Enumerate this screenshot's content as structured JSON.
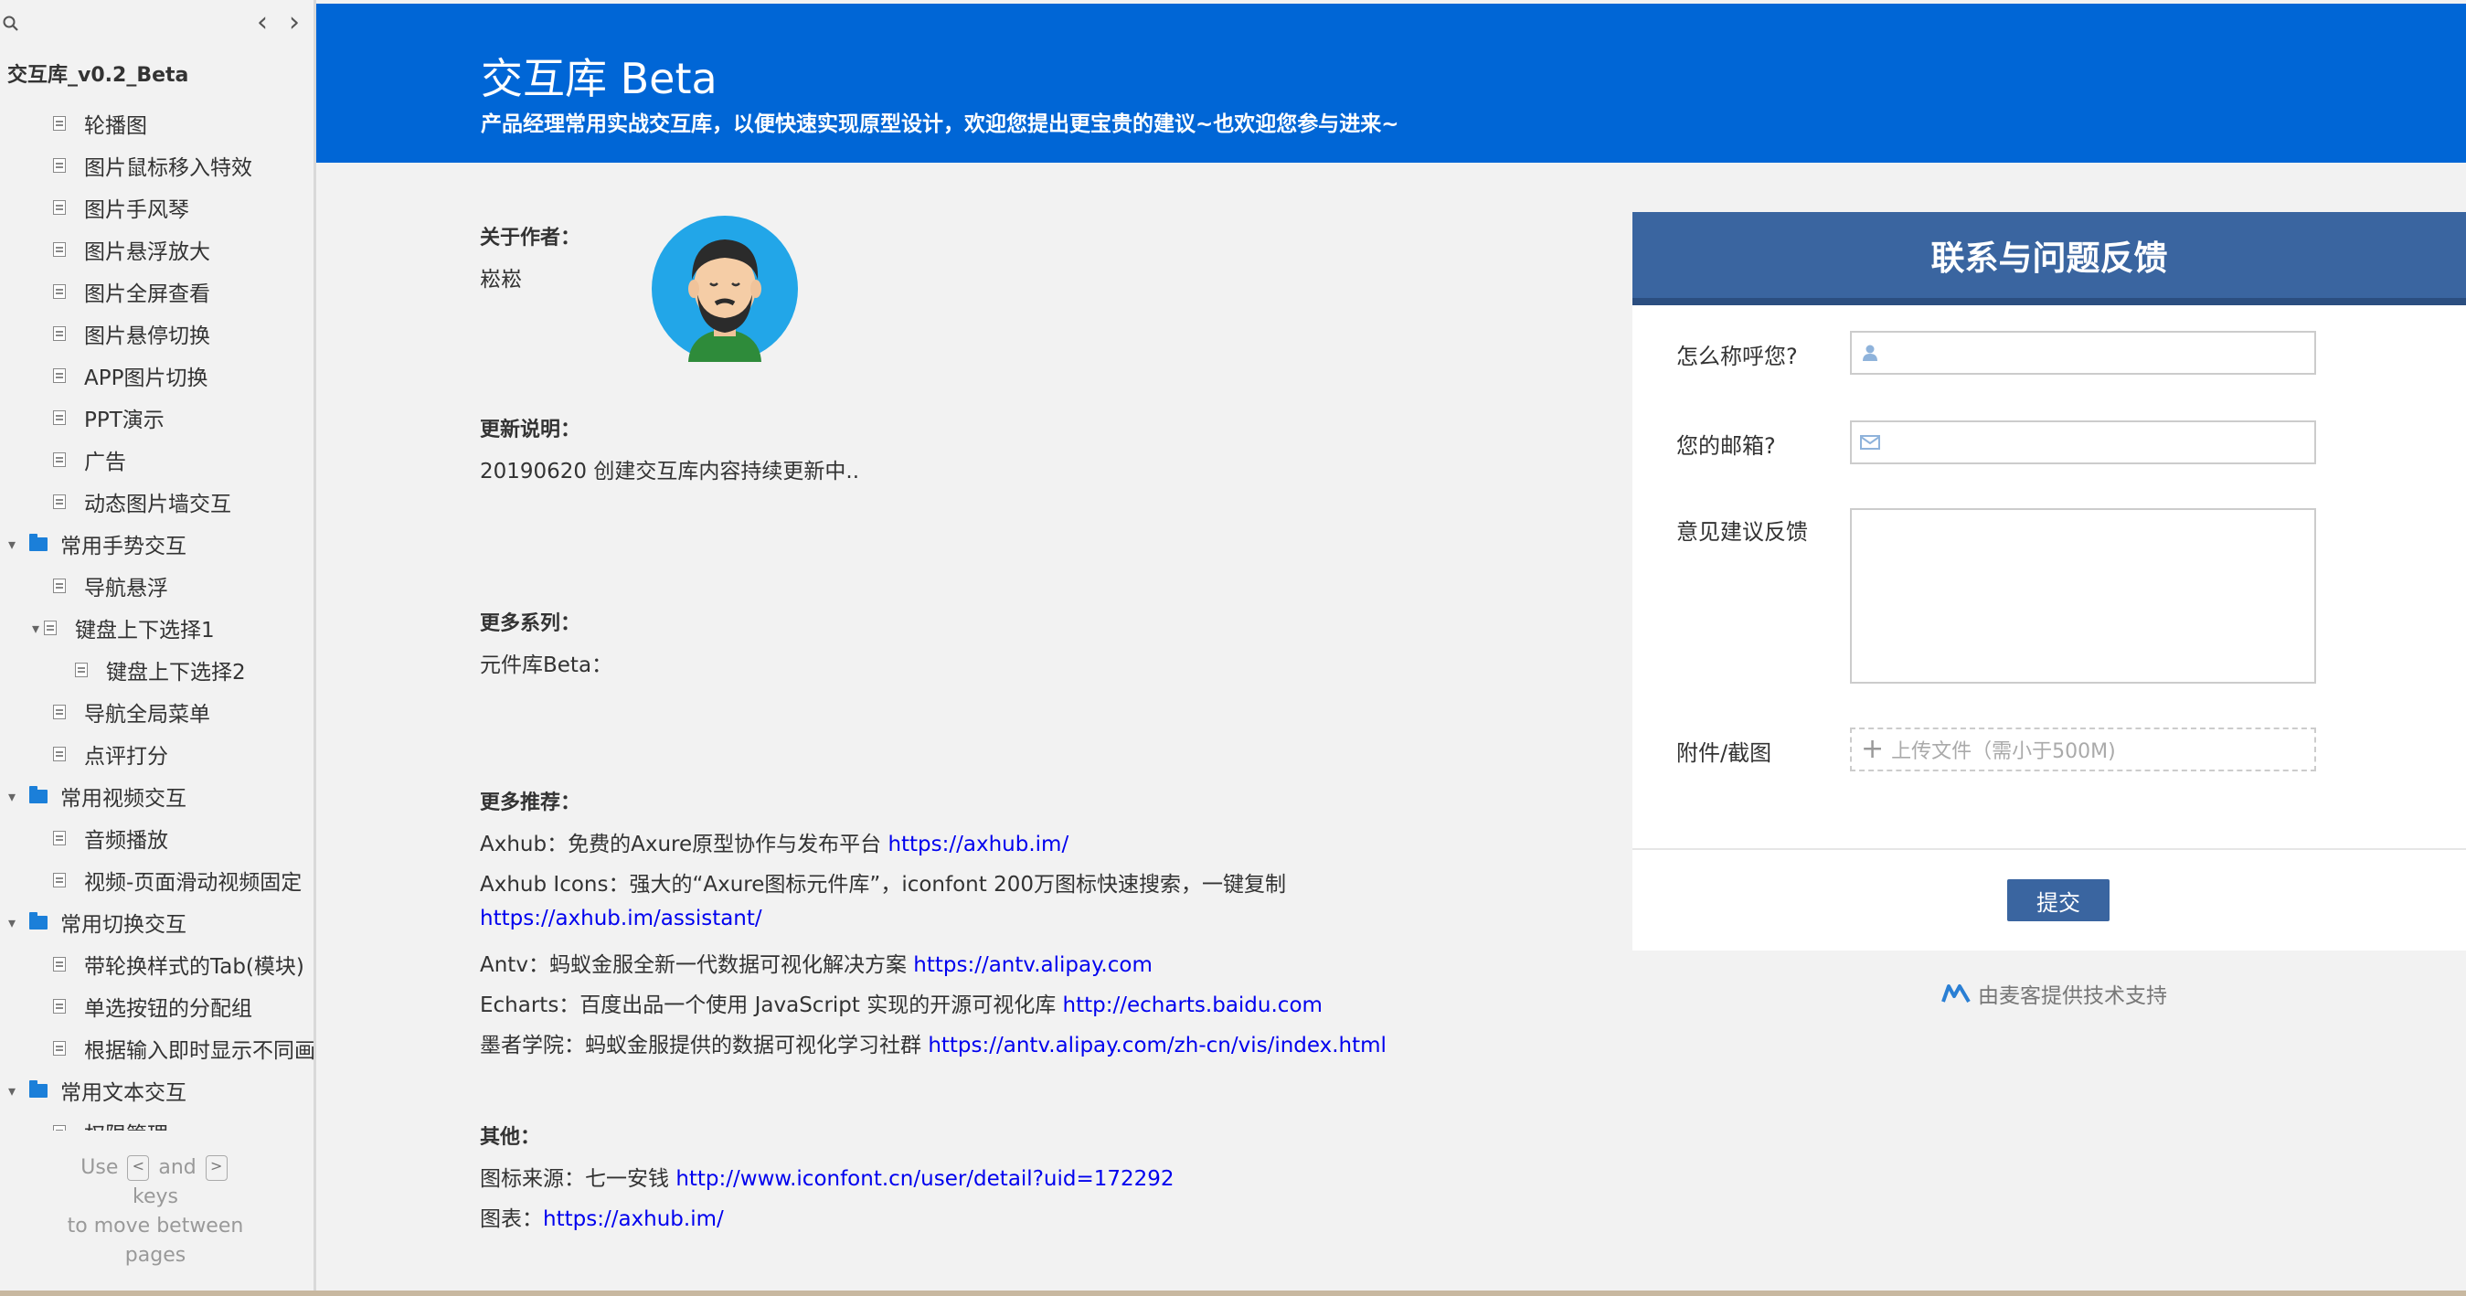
{
  "sidebar": {
    "title": "交互库_v0.2_Beta",
    "items": [
      {
        "label": "轮播图",
        "type": "page",
        "level": 1
      },
      {
        "label": "图片鼠标移入特效",
        "type": "page",
        "level": 1
      },
      {
        "label": "图片手风琴",
        "type": "page",
        "level": 1
      },
      {
        "label": "图片悬浮放大",
        "type": "page",
        "level": 1
      },
      {
        "label": "图片全屏查看",
        "type": "page",
        "level": 1
      },
      {
        "label": "图片悬停切换",
        "type": "page",
        "level": 1
      },
      {
        "label": "APP图片切换",
        "type": "page",
        "level": 1
      },
      {
        "label": "PPT演示",
        "type": "page",
        "level": 1
      },
      {
        "label": "广告",
        "type": "page",
        "level": 1
      },
      {
        "label": "动态图片墙交互",
        "type": "page",
        "level": 1
      },
      {
        "label": "常用手势交互",
        "type": "folder",
        "level": 0,
        "expanded": true
      },
      {
        "label": "导航悬浮",
        "type": "page",
        "level": 1
      },
      {
        "label": "键盘上下选择1",
        "type": "page",
        "level": 1,
        "expanded": true
      },
      {
        "label": "键盘上下选择2",
        "type": "page",
        "level": 2
      },
      {
        "label": "导航全局菜单",
        "type": "page",
        "level": 1
      },
      {
        "label": "点评打分",
        "type": "page",
        "level": 1
      },
      {
        "label": "常用视频交互",
        "type": "folder",
        "level": 0,
        "expanded": true
      },
      {
        "label": "音频播放",
        "type": "page",
        "level": 1
      },
      {
        "label": "视频-页面滑动视频固定",
        "type": "page",
        "level": 1
      },
      {
        "label": "常用切换交互",
        "type": "folder",
        "level": 0,
        "expanded": true
      },
      {
        "label": "带轮换样式的Tab(模块)",
        "type": "page",
        "level": 1
      },
      {
        "label": "单选按钮的分配组",
        "type": "page",
        "level": 1
      },
      {
        "label": "根据输入即时显示不同画",
        "type": "page",
        "level": 1
      },
      {
        "label": "常用文本交互",
        "type": "folder",
        "level": 0,
        "expanded": true
      },
      {
        "label": "权限管理",
        "type": "page",
        "level": 1
      }
    ],
    "help": {
      "use": "Use",
      "key_prev": "<",
      "and": "and",
      "key_next": ">",
      "keys": "keys",
      "line2": "to move between",
      "line3": "pages"
    }
  },
  "header": {
    "title": "交互库 Beta",
    "subtitle": "产品经理常用实战交互库，以便快速实现原型设计，欢迎您提出更宝贵的建议~也欢迎您参与进来~"
  },
  "main": {
    "author_label": "关于作者：",
    "author_name": "崧崧",
    "update_label": "更新说明：",
    "update_text": "20190620 创建交互库内容持续更新中..",
    "series_label": "更多系列：",
    "series_text": "元件库Beta：",
    "recommend_label": "更多推荐：",
    "recommend": [
      {
        "text": "Axhub：免费的Axure原型协作与发布平台 ",
        "link": "https://axhub.im/"
      },
      {
        "text": "Axhub Icons：强大的“Axure图标元件库”，iconfont 200万图标快速搜索，一键复制",
        "link": ""
      },
      {
        "text": "",
        "link": "https://axhub.im/assistant/"
      },
      {
        "text": "Antv：蚂蚁金服全新一代数据可视化解决方案 ",
        "link": "https://antv.alipay.com"
      },
      {
        "text": "Echarts：百度出品一个使用 JavaScript 实现的开源可视化库 ",
        "link": "http://echarts.baidu.com"
      },
      {
        "text": "墨者学院：蚂蚁金服提供的数据可视化学习社群 ",
        "link": "https://antv.alipay.com/zh-cn/vis/index.html"
      }
    ],
    "other_label": "其他：",
    "other": [
      {
        "text": "图标来源：七一安钱 ",
        "link": "http://www.iconfont.cn/user/detail?uid=172292"
      },
      {
        "text": "图表：",
        "link": "https://axhub.im/"
      }
    ]
  },
  "form": {
    "title": "联系与问题反馈",
    "name_label": "怎么称呼您?",
    "name_value": "",
    "email_label": "您的邮箱?",
    "email_value": "",
    "feedback_label": "意见建议反馈",
    "feedback_value": "",
    "attach_label": "附件/截图",
    "upload_text": "上传文件（需小于500M)",
    "submit_label": "提交"
  },
  "powered_by": "由麦客提供技术支持",
  "colors": {
    "header_bg": "#0066d6",
    "form_header_bg": "#3a65a0",
    "link": "#0000ee",
    "folder": "#1b7fd9"
  }
}
